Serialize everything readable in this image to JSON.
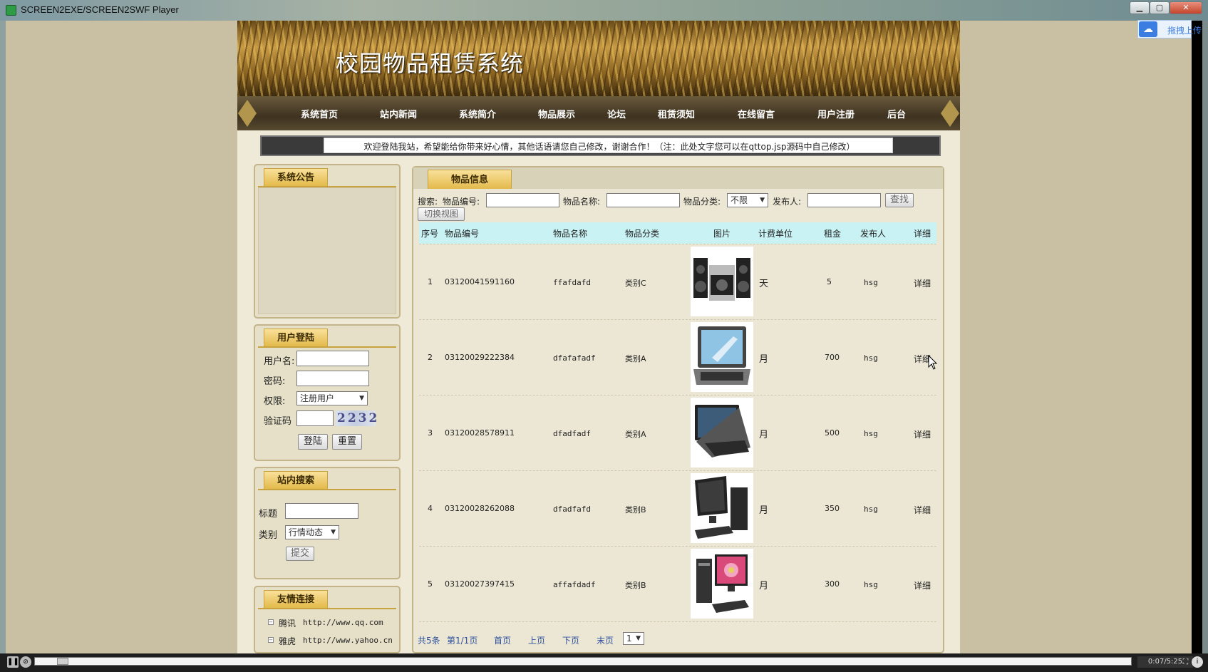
{
  "window": {
    "title": "SCREEN2EXE/SCREEN2SWF Player",
    "minimize_icon": "minimize-icon",
    "maximize_icon": "maximize-icon",
    "close_icon": "close-icon"
  },
  "cloud_upload": {
    "label": "拖拽上传",
    "icon": "cloud-icon"
  },
  "site": {
    "title": "校园物品租赁系统",
    "marquee": "欢迎登陆我站，希望能给你带来好心情，其他话语请您自己修改，谢谢合作！（注：此处文字您可以在qttop.jsp源码中自己修改）"
  },
  "nav": {
    "items": [
      {
        "label": "系统首页"
      },
      {
        "label": "站内新闻"
      },
      {
        "label": "系统简介"
      },
      {
        "label": "物品展示"
      },
      {
        "label": "论坛"
      },
      {
        "label": "租赁须知"
      },
      {
        "label": "在线留言"
      },
      {
        "label": "用户注册"
      },
      {
        "label": "后台"
      }
    ]
  },
  "sidebar": {
    "announcement": {
      "title": "系统公告"
    },
    "login": {
      "title": "用户登陆",
      "username_label": "用户名:",
      "password_label": "密码:",
      "role_label": "权限:",
      "role_selected": "注册用户",
      "captcha_label": "验证码",
      "captcha_value": "2232",
      "login_button": "登陆",
      "reset_button": "重置"
    },
    "site_search": {
      "title": "站内搜索",
      "title_label": "标题",
      "category_label": "类别",
      "category_selected": "行情动态",
      "submit_button": "提交"
    },
    "links": {
      "title": "友情连接",
      "items": [
        {
          "name": "腾讯",
          "url": "http://www.qq.com"
        },
        {
          "name": "雅虎",
          "url": "http://www.yahoo.cn"
        }
      ]
    }
  },
  "main": {
    "tab_title": "物品信息",
    "search": {
      "prefix": "搜索:",
      "code_label": "物品编号:",
      "name_label": "物品名称:",
      "category_label": "物品分类:",
      "category_selected": "不限",
      "publisher_label": "发布人:",
      "search_button": "查找",
      "switch_view_button": "切换视图"
    },
    "table": {
      "columns": [
        "序号",
        "物品编号",
        "物品名称",
        "物品分类",
        "图片",
        "计费单位",
        "租金",
        "发布人",
        "详细"
      ],
      "rows": [
        {
          "no": "1",
          "code": "03120041591160",
          "name": "ffafdafd",
          "category": "类别C",
          "image": "speakers-image",
          "unit": "天",
          "rent": "5",
          "publisher": "hsg",
          "detail": "详细"
        },
        {
          "no": "2",
          "code": "03120029222384",
          "name": "dfafafadf",
          "category": "类别A",
          "image": "laptop-image",
          "unit": "月",
          "rent": "700",
          "publisher": "hsg",
          "detail": "详细"
        },
        {
          "no": "3",
          "code": "03120028578911",
          "name": "dfadfadf",
          "category": "类别A",
          "image": "laptop-image",
          "unit": "月",
          "rent": "500",
          "publisher": "hsg",
          "detail": "详细"
        },
        {
          "no": "4",
          "code": "03120028262088",
          "name": "dfadfafd",
          "category": "类别B",
          "image": "desktop-computer-image",
          "unit": "月",
          "rent": "350",
          "publisher": "hsg",
          "detail": "详细"
        },
        {
          "no": "5",
          "code": "03120027397415",
          "name": "affafdadf",
          "category": "类别B",
          "image": "desktop-computer-image",
          "unit": "月",
          "rent": "300",
          "publisher": "hsg",
          "detail": "详细"
        }
      ]
    },
    "pager": {
      "total": "共5条",
      "page_info": "第1/1页",
      "first": "首页",
      "prev": "上页",
      "next": "下页",
      "last": "末页",
      "page_select": "1"
    }
  },
  "player": {
    "time": "0:07/5:25",
    "progress": 0.02
  }
}
